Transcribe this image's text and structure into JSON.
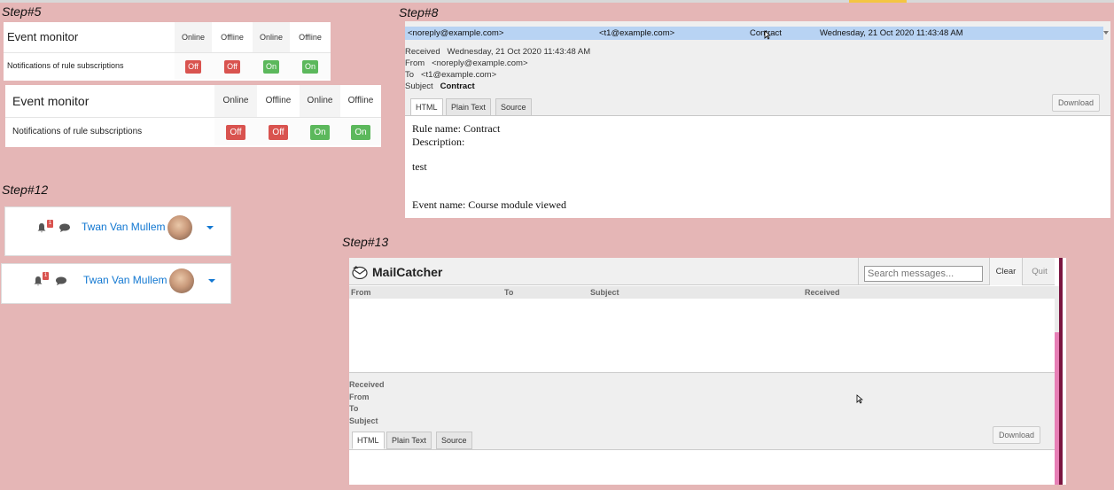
{
  "steps": {
    "s5": "Step#5",
    "s8": "Step#8",
    "s12": "Step#12",
    "s13": "Step#13"
  },
  "event_monitor": {
    "title": "Event monitor",
    "columns": [
      "Online",
      "Offline",
      "Online",
      "Offline"
    ],
    "row_label": "Notifications of rule subscriptions",
    "states": [
      "Off",
      "Off",
      "On",
      "On"
    ]
  },
  "navbar": {
    "user_name": "Twan Van Mullem",
    "notif_count": "1"
  },
  "mail_detail": {
    "list_row": {
      "from": "<noreply@example.com>",
      "to": "<t1@example.com>",
      "subject": "Contract",
      "received": "Wednesday, 21 Oct 2020 11:43:48 AM"
    },
    "labels": {
      "received": "Received",
      "from": "From",
      "to": "To",
      "subject": "Subject"
    },
    "values": {
      "received": "Wednesday, 21 Oct 2020 11:43:48 AM",
      "from": "<noreply@example.com>",
      "to": "<t1@example.com>",
      "subject": "Contract"
    },
    "tabs": [
      "HTML",
      "Plain Text",
      "Source"
    ],
    "download": "Download",
    "body": {
      "line1": "Rule name: Contract",
      "line2": "Description:",
      "line3": "test",
      "line4": "Event name: Course module viewed"
    }
  },
  "mailcatcher": {
    "title": "MailCatcher",
    "search_placeholder": "Search messages...",
    "clear": "Clear",
    "quit": "Quit",
    "columns": [
      "From",
      "To",
      "Subject",
      "Received"
    ],
    "labels": {
      "received": "Received",
      "from": "From",
      "to": "To",
      "subject": "Subject"
    },
    "tabs": [
      "HTML",
      "Plain Text",
      "Source"
    ],
    "download": "Download"
  },
  "colors": {
    "background": "#e5b6b6",
    "off": "#d9534f",
    "on": "#5cb85c",
    "link": "#1177d1",
    "selected_row": "#b8d3f3"
  }
}
